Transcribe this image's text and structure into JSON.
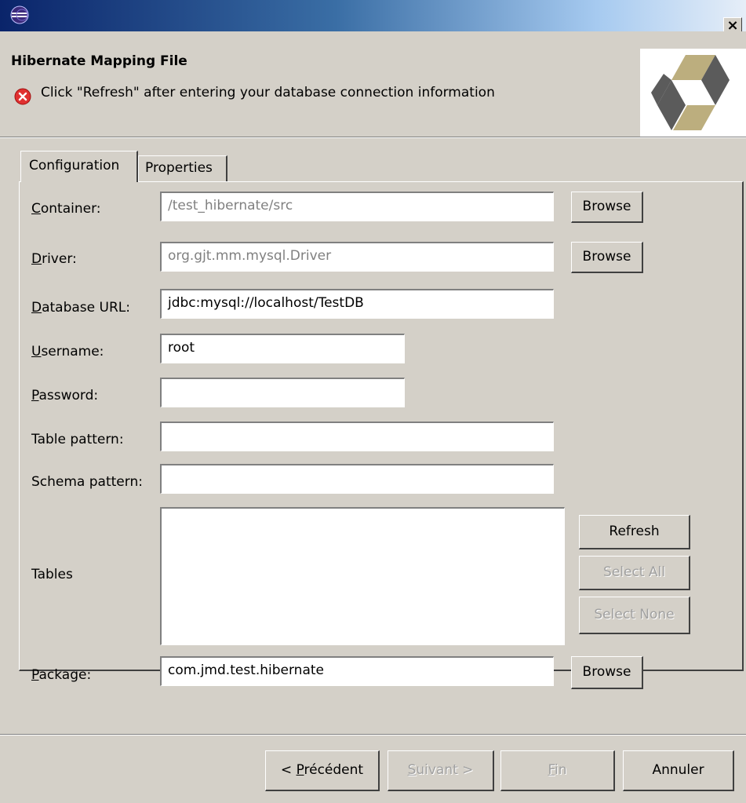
{
  "window": {
    "close_glyph": "×",
    "app_icon": "eclipse-icon"
  },
  "header": {
    "title": "Hibernate Mapping File",
    "message": "Click \"Refresh\" after entering your database connection information",
    "message_icon": "error-icon",
    "banner_icon": "hibernate-logo"
  },
  "tabs": [
    {
      "label": "Configuration",
      "active": true
    },
    {
      "label": "Properties",
      "active": false
    }
  ],
  "form": {
    "container": {
      "label_mnemonic": "C",
      "label_rest": "ontainer:",
      "value": "/test_hibernate/src",
      "button": "Browse"
    },
    "driver": {
      "label_mnemonic": "D",
      "label_rest": "river:",
      "value": "org.gjt.mm.mysql.Driver",
      "button": "Browse"
    },
    "database_url": {
      "label_mnemonic": "D",
      "label_rest": "atabase URL:",
      "value": "jdbc:mysql://localhost/TestDB"
    },
    "username": {
      "label_mnemonic": "U",
      "label_rest": "sername:",
      "value": "root"
    },
    "password": {
      "label_mnemonic": "P",
      "label_rest": "assword:",
      "value": ""
    },
    "table_pattern": {
      "label": "Table pattern:",
      "value": ""
    },
    "schema_pattern": {
      "label": "Schema pattern:",
      "value": ""
    },
    "tables": {
      "label": "Tables",
      "refresh": "Refresh",
      "select_all": "Select All",
      "select_none": "Select None"
    },
    "package": {
      "label_mnemonic": "P",
      "label_rest": "ackage:",
      "value": "com.jmd.test.hibernate",
      "button": "Browse"
    }
  },
  "footer": {
    "back_prefix": "< ",
    "back_mnemonic": "P",
    "back_rest": "récédent",
    "next_mnemonic": "S",
    "next_rest": "uivant >",
    "finish_mnemonic": "F",
    "finish_rest": "in",
    "cancel": "Annuler"
  },
  "colors": {
    "dialog_bg": "#d4d0c8",
    "titlebar_start": "#0a246a",
    "titlebar_end": "#a6caf0",
    "error_red": "#e03030",
    "disabled_text": "#a0a0a0"
  }
}
